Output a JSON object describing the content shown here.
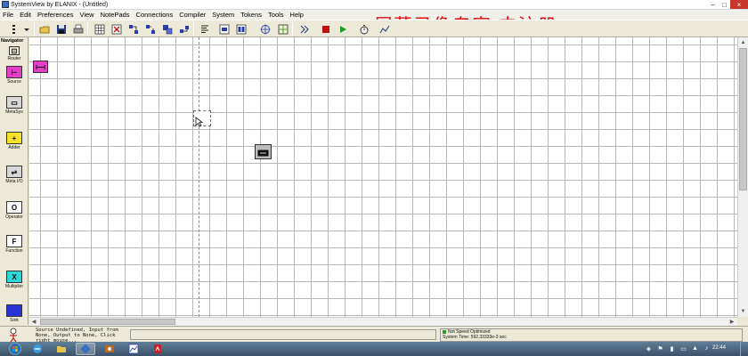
{
  "window": {
    "title": "SystemView by ELANIX - (Untitled)",
    "min_label": "–",
    "max_label": "□",
    "close_label": "×"
  },
  "menu": [
    "File",
    "Edit",
    "Preferences",
    "View",
    "NotePads",
    "Connections",
    "Compiler",
    "System",
    "Tokens",
    "Tools",
    "Help"
  ],
  "watermark": "屏幕录像专家  未注册",
  "navigator": {
    "title": "Navigator",
    "items": [
      {
        "label": "Router",
        "glyph": "⊡",
        "color": "#ece9d8"
      },
      {
        "label": "Source",
        "glyph": "⊢",
        "color": "#e23ec6"
      },
      {
        "label": "MetaSys",
        "glyph": "▭",
        "color": "#d8d8d8"
      },
      {
        "label": "Adder",
        "glyph": "+",
        "color": "#f5e32a"
      },
      {
        "label": "Meta I/O",
        "glyph": "⇌",
        "color": "#d8d8d8"
      },
      {
        "label": "Operator",
        "glyph": "O",
        "color": "#ffffff"
      },
      {
        "label": "Function",
        "glyph": "F",
        "color": "#ffffff"
      },
      {
        "label": "Multiplier",
        "glyph": "X",
        "color": "#2ad8d8"
      },
      {
        "label": "Sink",
        "glyph": "",
        "color": "#2a33d8"
      }
    ]
  },
  "canvas": {
    "tokens": [
      {
        "name": "source-token",
        "kind": "source"
      },
      {
        "name": "sink-token",
        "kind": "sink"
      }
    ]
  },
  "status": {
    "message": "Source Undefined, Input from None, Output to None, Click right mouse...",
    "speed": "Not Speed Optimized",
    "system_time": "System Time: 592.33333e-3 sec"
  },
  "taskbar": {
    "clock": "22:44"
  },
  "colors": {
    "watermark": "#e01010",
    "run_green": "#1f9c1f",
    "stop_red": "#c01010"
  }
}
